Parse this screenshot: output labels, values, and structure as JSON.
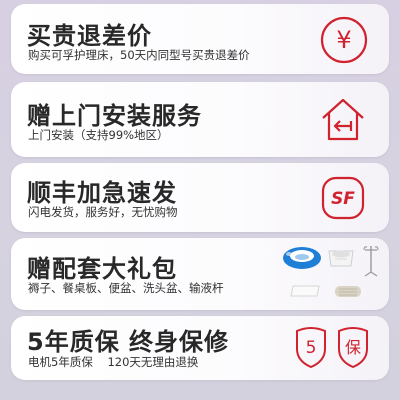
{
  "cards": [
    {
      "title": "买贵退差价",
      "subtitle": "购买可孚护理床，50天内同型号买贵退差价",
      "icon": "yen-circle-icon"
    },
    {
      "title": "赠上门安装服务",
      "subtitle": "上门安装（支持99%地区）",
      "icon": "house-arrow-icon"
    },
    {
      "title": "顺丰加急速发",
      "subtitle": "闪电发货，服务好，无忧购物",
      "icon": "sf-express-icon"
    },
    {
      "title": "赠配套大礼包",
      "subtitle": "褥子、餐桌板、便盆、洗头盆、输液杆",
      "icon": "gift-bundle-icon"
    },
    {
      "title": "5年质保 终身保修",
      "subtitle": "电机5年质保    120天无理由退换",
      "icon_badges": [
        "5",
        "保"
      ]
    }
  ],
  "colors": {
    "accent": "#d0232f",
    "title": "#282828",
    "subtitle": "#333333"
  },
  "icons": {
    "yen": "¥",
    "sf": "SF"
  }
}
